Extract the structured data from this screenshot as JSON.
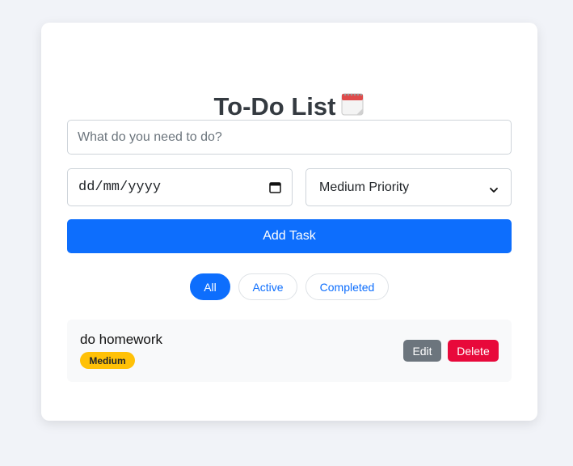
{
  "app": {
    "title": "To-Do List",
    "title_icon": "calendar-emoji"
  },
  "form": {
    "task_placeholder": "What do you need to do?",
    "task_value": "",
    "date_placeholder": "dd/mm/yyyy",
    "priority_selected": "Medium Priority",
    "add_button_label": "Add Task"
  },
  "filters": [
    {
      "label": "All",
      "selected": true
    },
    {
      "label": "Active",
      "selected": false
    },
    {
      "label": "Completed",
      "selected": false
    }
  ],
  "tasks": [
    {
      "text": "do homework",
      "priority": "Medium",
      "edit_label": "Edit",
      "delete_label": "Delete"
    }
  ],
  "colors": {
    "primary": "#0d6efd",
    "medium_badge": "#ffc107",
    "edit": "#6c757d",
    "delete": "#e8093b"
  }
}
